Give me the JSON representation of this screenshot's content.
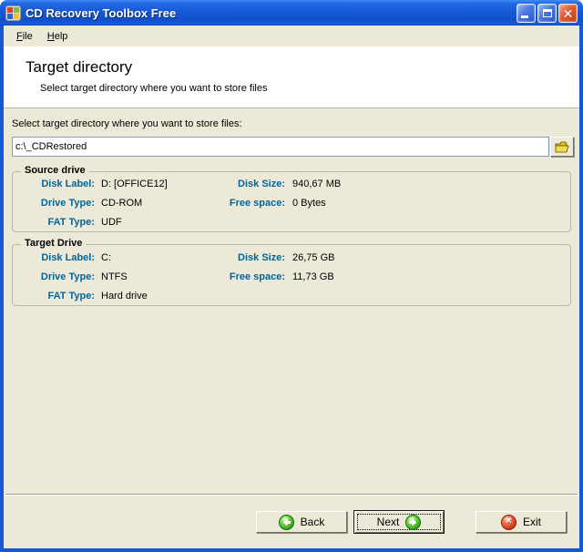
{
  "window": {
    "title": "CD Recovery Toolbox Free",
    "icons": {
      "app": "windows-squares-icon",
      "minimize": "minimize-icon",
      "maximize": "maximize-icon",
      "close": "close-icon"
    }
  },
  "menu": {
    "items": [
      {
        "label": "File"
      },
      {
        "label": "Help"
      }
    ]
  },
  "header": {
    "title": "Target directory",
    "subtitle": "Select target directory where you want to store files"
  },
  "form": {
    "label": "Select target directory where you want to store files:",
    "path_value": "c:\\_CDRestored",
    "browse_icon": "open-folder-icon"
  },
  "source_drive": {
    "title": "Source drive",
    "rows": [
      {
        "label1": "Disk Label:",
        "value1": "D: [OFFICE12]",
        "label2": "Disk Size:",
        "value2": "940,67 MB"
      },
      {
        "label1": "Drive Type:",
        "value1": "CD-ROM",
        "label2": "Free space:",
        "value2": "0 Bytes"
      },
      {
        "label1": "FAT Type:",
        "value1": "UDF",
        "label2": "",
        "value2": ""
      }
    ]
  },
  "target_drive": {
    "title": "Target Drive",
    "rows": [
      {
        "label1": "Disk Label:",
        "value1": "C:",
        "label2": "Disk Size:",
        "value2": "26,75 GB"
      },
      {
        "label1": "Drive Type:",
        "value1": "NTFS",
        "label2": "Free space:",
        "value2": "11,73 GB"
      },
      {
        "label1": "FAT Type:",
        "value1": "Hard drive",
        "label2": "",
        "value2": ""
      }
    ]
  },
  "buttons": {
    "back": {
      "label": "Back",
      "icon": "green-left-arrow-icon"
    },
    "next": {
      "label": "Next",
      "icon": "green-right-arrow-icon",
      "focused": true
    },
    "exit": {
      "label": "Exit",
      "icon": "red-x-icon"
    }
  },
  "colors": {
    "titlebar_blue": "#1557D4",
    "client_beige": "#ECE9D8",
    "header_white": "#FFFFFF",
    "field_label_blue": "#006699",
    "input_border": "#7F9DB9",
    "back_next_green": "#50BE2E",
    "exit_red": "#D33C1C"
  }
}
